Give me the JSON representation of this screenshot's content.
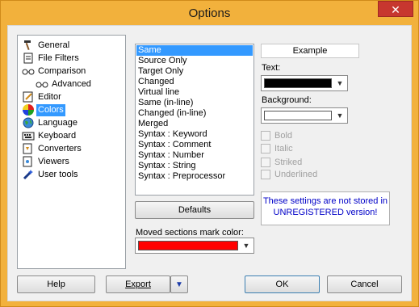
{
  "window": {
    "title": "Options",
    "close_glyph": "✕"
  },
  "tree": {
    "items": [
      {
        "label": "General",
        "icon": "hammer-icon",
        "glyph": "🔨"
      },
      {
        "label": "File Filters",
        "icon": "document-icon",
        "glyph": "🗎"
      },
      {
        "label": "Comparison",
        "icon": "glasses-icon",
        "glyph": "👓"
      },
      {
        "label": "Advanced",
        "icon": "glasses-icon",
        "glyph": "👓"
      },
      {
        "label": "Editor",
        "icon": "pencil-icon",
        "glyph": "✎"
      },
      {
        "label": "Colors",
        "icon": "color-wheel-icon",
        "glyph": ""
      },
      {
        "label": "Language",
        "icon": "globe-icon",
        "glyph": "🌐"
      },
      {
        "label": "Keyboard",
        "icon": "keyboard-icon",
        "glyph": "⌨"
      },
      {
        "label": "Converters",
        "icon": "converter-icon",
        "glyph": "🗎"
      },
      {
        "label": "Viewers",
        "icon": "viewer-icon",
        "glyph": "🗎"
      },
      {
        "label": "User tools",
        "icon": "wand-icon",
        "glyph": "✦"
      }
    ],
    "selected": "Colors"
  },
  "sections": {
    "items": [
      "Same",
      "Source Only",
      "Target Only",
      "Changed",
      "Virtual line",
      "Same (in-line)",
      "Changed (in-line)",
      "Merged",
      "Syntax : Keyword",
      "Syntax : Comment",
      "Syntax : Number",
      "Syntax : String",
      "Syntax : Preprocessor"
    ],
    "selected": "Same"
  },
  "defaults_label": "Defaults",
  "moved_sections": {
    "label": "Moved sections mark color:",
    "color": "#ff0000"
  },
  "example": {
    "label": "Example"
  },
  "text_color": {
    "label": "Text:",
    "color": "#000000"
  },
  "background_color": {
    "label": "Background:",
    "color": "#ffffff"
  },
  "styles": {
    "bold": "Bold",
    "italic": "Italic",
    "striked": "Striked",
    "underlined": "Underlined"
  },
  "notice": {
    "line1": "These settings are not stored in",
    "line2": "UNREGISTERED version!"
  },
  "footer": {
    "help": "Help",
    "export": "Export",
    "ok": "OK",
    "cancel": "Cancel"
  },
  "colors": {
    "title_bar": "#f2b13c",
    "selection": "#3399ff",
    "notice_text": "#0000c8"
  }
}
